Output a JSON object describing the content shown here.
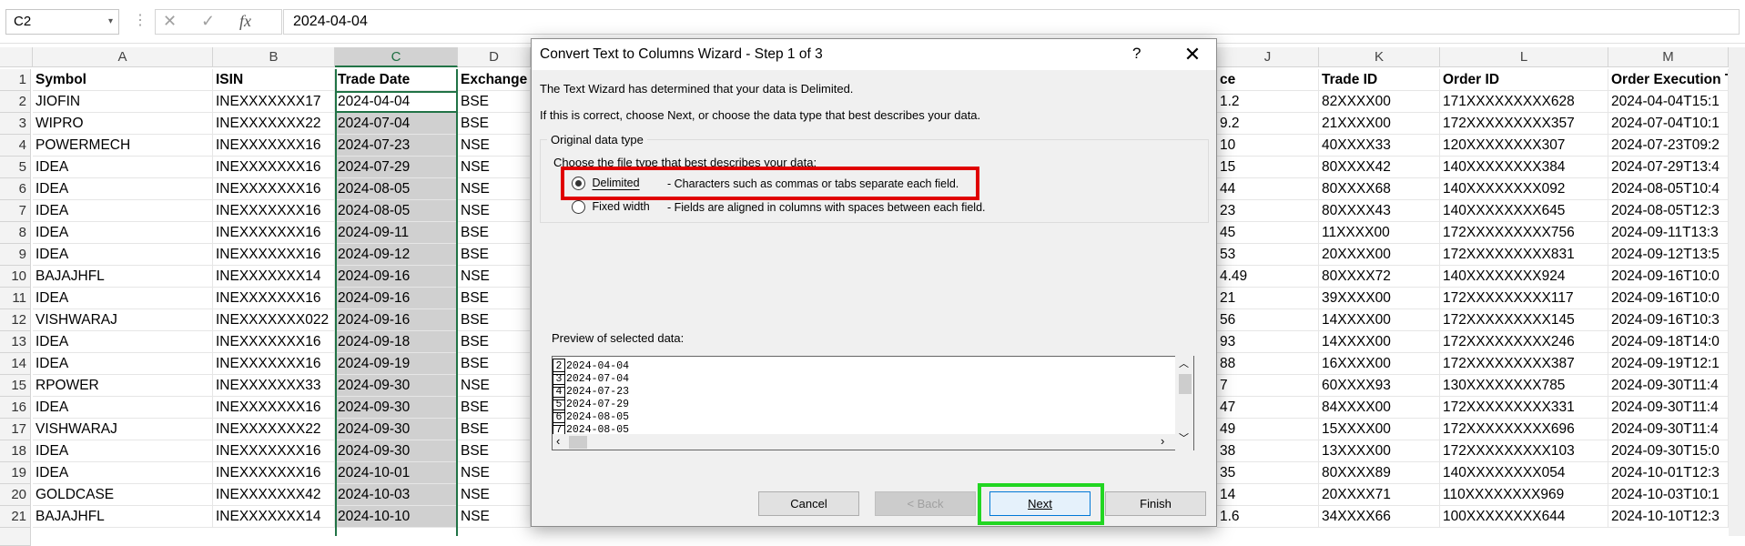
{
  "formula_bar": {
    "name_box": "C2",
    "dropdown_glyph": "▾",
    "dots": "⋮",
    "cancel_glyph": "✕",
    "enter_glyph": "✓",
    "fx_glyph": "fx",
    "value": "2024-04-04"
  },
  "columns": [
    "A",
    "B",
    "C",
    "D",
    "J",
    "K",
    "L",
    "M"
  ],
  "headers": {
    "A": "Symbol",
    "B": "ISIN",
    "C": "Trade Date",
    "D": "Exchange",
    "J": "ce",
    "K": "Trade ID",
    "L": "Order ID",
    "M": "Order Execution T"
  },
  "rows": [
    {
      "n": "1"
    },
    {
      "n": "2",
      "A": "JIOFIN",
      "B": "INEXXXXXXX17",
      "C": "2024-04-04",
      "D": "BSE",
      "J": "1.2",
      "K": "82XXXX00",
      "L": "171XXXXXXXXX628",
      "M": "2024-04-04T15:1"
    },
    {
      "n": "3",
      "A": "WIPRO",
      "B": "INEXXXXXXX22",
      "C": "2024-07-04",
      "D": "BSE",
      "J": "9.2",
      "K": "21XXXX00",
      "L": "172XXXXXXXXX357",
      "M": "2024-07-04T10:1"
    },
    {
      "n": "4",
      "A": "POWERMECH",
      "B": "INEXXXXXXX16",
      "C": "2024-07-23",
      "D": "NSE",
      "J": "10",
      "K": "40XXXX33",
      "L": "120XXXXXXXX307",
      "M": "2024-07-23T09:2"
    },
    {
      "n": "5",
      "A": "IDEA",
      "B": "INEXXXXXXX16",
      "C": "2024-07-29",
      "D": "NSE",
      "J": "15",
      "K": "80XXXX42",
      "L": "140XXXXXXXX384",
      "M": "2024-07-29T13:4"
    },
    {
      "n": "6",
      "A": "IDEA",
      "B": "INEXXXXXXX16",
      "C": "2024-08-05",
      "D": "NSE",
      "J": "44",
      "K": "80XXXX68",
      "L": "140XXXXXXXX092",
      "M": "2024-08-05T10:4"
    },
    {
      "n": "7",
      "A": "IDEA",
      "B": "INEXXXXXXX16",
      "C": "2024-08-05",
      "D": "NSE",
      "J": "23",
      "K": "80XXXX43",
      "L": "140XXXXXXXX645",
      "M": "2024-08-05T12:3"
    },
    {
      "n": "8",
      "A": "IDEA",
      "B": "INEXXXXXXX16",
      "C": "2024-09-11",
      "D": "BSE",
      "J": "45",
      "K": "11XXXX00",
      "L": "172XXXXXXXXX756",
      "M": "2024-09-11T13:3"
    },
    {
      "n": "9",
      "A": "IDEA",
      "B": "INEXXXXXXX16",
      "C": "2024-09-12",
      "D": "BSE",
      "J": "53",
      "K": "20XXXX00",
      "L": "172XXXXXXXXX831",
      "M": "2024-09-12T13:5"
    },
    {
      "n": "10",
      "A": "BAJAJHFL",
      "B": "INEXXXXXXX14",
      "C": "2024-09-16",
      "D": "NSE",
      "J": "4.49",
      "K": "80XXXX72",
      "L": "140XXXXXXXX924",
      "M": "2024-09-16T10:0"
    },
    {
      "n": "11",
      "A": "IDEA",
      "B": "INEXXXXXXX16",
      "C": "2024-09-16",
      "D": "BSE",
      "J": "21",
      "K": "39XXXX00",
      "L": "172XXXXXXXXX117",
      "M": "2024-09-16T10:0"
    },
    {
      "n": "12",
      "A": "VISHWARAJ",
      "B": "INEXXXXXXX022",
      "C": "2024-09-16",
      "D": "BSE",
      "J": "56",
      "K": "14XXXX00",
      "L": "172XXXXXXXXX145",
      "M": "2024-09-16T10:3"
    },
    {
      "n": "13",
      "A": "IDEA",
      "B": "INEXXXXXXX16",
      "C": "2024-09-18",
      "D": "BSE",
      "J": "93",
      "K": "14XXXX00",
      "L": "172XXXXXXXXX246",
      "M": "2024-09-18T14:0"
    },
    {
      "n": "14",
      "A": "IDEA",
      "B": "INEXXXXXXX16",
      "C": "2024-09-19",
      "D": "BSE",
      "J": "88",
      "K": "16XXXX00",
      "L": "172XXXXXXXXX387",
      "M": "2024-09-19T12:1"
    },
    {
      "n": "15",
      "A": "RPOWER",
      "B": "INEXXXXXXX33",
      "C": "2024-09-30",
      "D": "NSE",
      "J": "7",
      "K": "60XXXX93",
      "L": "130XXXXXXXX785",
      "M": "2024-09-30T11:4"
    },
    {
      "n": "16",
      "A": "IDEA",
      "B": "INEXXXXXXX16",
      "C": "2024-09-30",
      "D": "BSE",
      "J": "47",
      "K": "84XXXX00",
      "L": "172XXXXXXXXX331",
      "M": "2024-09-30T11:4"
    },
    {
      "n": "17",
      "A": "VISHWARAJ",
      "B": "INEXXXXXXX22",
      "C": "2024-09-30",
      "D": "BSE",
      "J": "49",
      "K": "15XXXX00",
      "L": "172XXXXXXXXX696",
      "M": "2024-09-30T11:4"
    },
    {
      "n": "18",
      "A": "IDEA",
      "B": "INEXXXXXXX16",
      "C": "2024-09-30",
      "D": "BSE",
      "J": "38",
      "K": "13XXXX00",
      "L": "172XXXXXXXXX103",
      "M": "2024-09-30T15:0"
    },
    {
      "n": "19",
      "A": "IDEA",
      "B": "INEXXXXXXX16",
      "C": "2024-10-01",
      "D": "NSE",
      "J": "35",
      "K": "80XXXX89",
      "L": "140XXXXXXXX054",
      "M": "2024-10-01T12:3"
    },
    {
      "n": "20",
      "A": "GOLDCASE",
      "B": "INEXXXXXXX42",
      "C": "2024-10-03",
      "D": "NSE",
      "J": "14",
      "K": "20XXXX71",
      "L": "110XXXXXXXX969",
      "M": "2024-10-03T10:1"
    },
    {
      "n": "21",
      "A": "BAJAJHFL",
      "B": "INEXXXXXXX14",
      "C": "2024-10-10",
      "D": "NSE",
      "J": "1.6",
      "K": "34XXXX66",
      "L": "100XXXXXXXX644",
      "M": "2024-10-10T12:3"
    }
  ],
  "dialog": {
    "title": "Convert Text to Columns Wizard - Step 1 of 3",
    "help": "?",
    "close": "✕",
    "line1": "The Text Wizard has determined that your data is Delimited.",
    "line2": "If this is correct, choose Next, or choose the data type that best describes your data.",
    "group_label": "Original data type",
    "choose_label": "Choose the file type that best describes your data:",
    "opt1_label": "Delimited",
    "opt1_desc": "- Characters such as commas or tabs separate each field.",
    "opt2_label": "Fixed width",
    "opt2_desc": "- Fields are aligned in columns with spaces between each field.",
    "preview_label": "Preview of selected data:",
    "preview_lines": [
      {
        "n": "2",
        "t": "2024-04-04"
      },
      {
        "n": "3",
        "t": "2024-07-04"
      },
      {
        "n": "4",
        "t": "2024-07-23"
      },
      {
        "n": "5",
        "t": "2024-07-29"
      },
      {
        "n": "6",
        "t": "2024-08-05"
      },
      {
        "n": "7",
        "t": "2024-08-05"
      }
    ],
    "buttons": {
      "cancel": "Cancel",
      "back": "< Back",
      "next": "Next",
      "finish": "Finish"
    }
  },
  "colors": {
    "excel_green": "#217346",
    "highlight_red": "#e00000",
    "highlight_green": "#22d622"
  }
}
